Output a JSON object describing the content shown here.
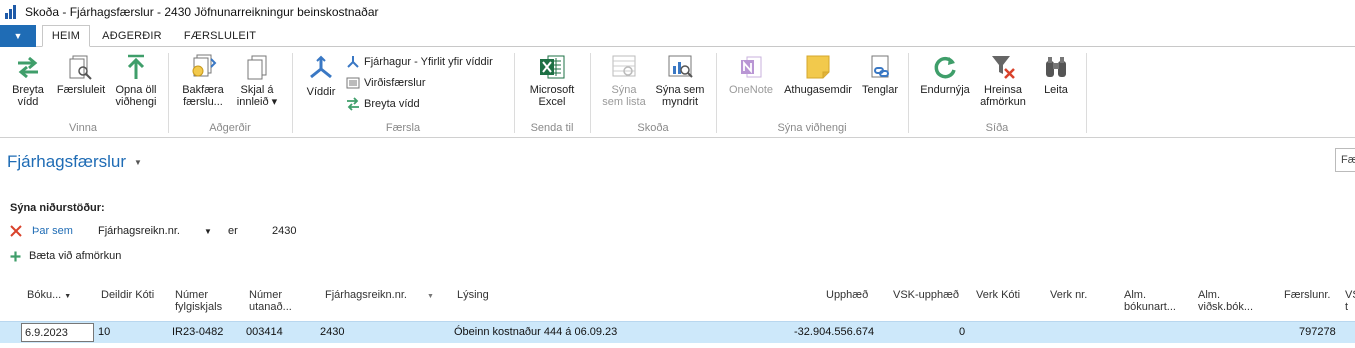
{
  "window": {
    "title": "Skoða - Fjárhagsfærslur - 2430 Jöfnunarreikningur beinskostnaðar"
  },
  "tabs": [
    {
      "label": "HEIM",
      "active": true
    },
    {
      "label": "AÐGERÐIR",
      "active": false
    },
    {
      "label": "FÆRSLULEIT",
      "active": false
    }
  ],
  "ribbon": {
    "groups": {
      "vinna": "Vinna",
      "adgerdir": "Aðgerðir",
      "faersla": "Færsla",
      "senda_til": "Senda til",
      "skoda": "Skoða",
      "syna_vidhengi": "Sýna viðhengi",
      "sida": "Síða"
    },
    "buttons": {
      "breyta_vidd": [
        "Breyta",
        "vídd"
      ],
      "faersluleit": [
        "Færsluleit"
      ],
      "opna_oll_vidhengi": [
        "Opna öll",
        "viðhengi"
      ],
      "bakfaera": [
        "Bakfæra",
        "færslu..."
      ],
      "skjal_a": [
        "Skjal á",
        "innleið ▾"
      ],
      "viddir": [
        "Víddir"
      ],
      "fjarhagur_yfirlit": "Fjárhagur - Yfirlit yfir víddir",
      "virdisfaerslur": "Virðisfærslur",
      "breyta_vidd_small": "Breyta vídd",
      "microsoft_excel": [
        "Microsoft",
        "Excel"
      ],
      "syna_sem_lista": [
        "Sýna",
        "sem lista"
      ],
      "syna_sem_myndrit": [
        "Sýna sem",
        "myndrit"
      ],
      "onenote": [
        "OneNote"
      ],
      "athugasemdir": [
        "Athugasemdir"
      ],
      "tenglar": [
        "Tenglar"
      ],
      "endurnyja": [
        "Endurnýja"
      ],
      "hreinsa_afmorkun": [
        "Hreinsa",
        "afmörkun"
      ],
      "leita": [
        "Leita"
      ]
    }
  },
  "page": {
    "title": "Fjárhagsfærslur",
    "search_placeholder": "Fær"
  },
  "filters": {
    "heading": "Sýna niðurstöður:",
    "row": {
      "prefix": "Þar sem",
      "field": "Fjárhagsreikn.nr.",
      "operator": "er",
      "value": "2430"
    },
    "add_label": "Bæta við afmörkun"
  },
  "grid": {
    "columns": [
      [
        "Bóku..."
      ],
      [
        "Deildir Kóti"
      ],
      [
        "Númer",
        "fylgiskjals"
      ],
      [
        "Númer",
        "utanað..."
      ],
      [
        "Fjárhagsreikn.nr."
      ],
      [
        "Lýsing"
      ],
      [
        "Upphæð"
      ],
      [
        "VSK-upphæð"
      ],
      [
        "Verk Kóti"
      ],
      [
        "Verk nr."
      ],
      [
        "Alm.",
        "bókunart..."
      ],
      [
        "Alm.",
        "viðsk.bók..."
      ],
      [
        "Færslunr."
      ],
      [
        "VS",
        "t"
      ]
    ],
    "rows": [
      {
        "date": "6.9.2023",
        "dept": "10",
        "doc_no": "IR23-0482",
        "ext_doc_no": "003414",
        "gl_account": "2430",
        "description": "Óbeinn kostnaður 444 á 06.09.23",
        "amount": "-32.904.556.674",
        "vat_amount": "0",
        "entry_no": "797278"
      }
    ]
  },
  "colors": {
    "accent": "#1f6cb5",
    "selected_row": "#cde8fa",
    "green_icon": "#3f9e6a",
    "excel": "#1d7044",
    "onenote": "#7b3aa8",
    "note_yellow": "#f2c94c",
    "filter_red": "#d9422b"
  }
}
